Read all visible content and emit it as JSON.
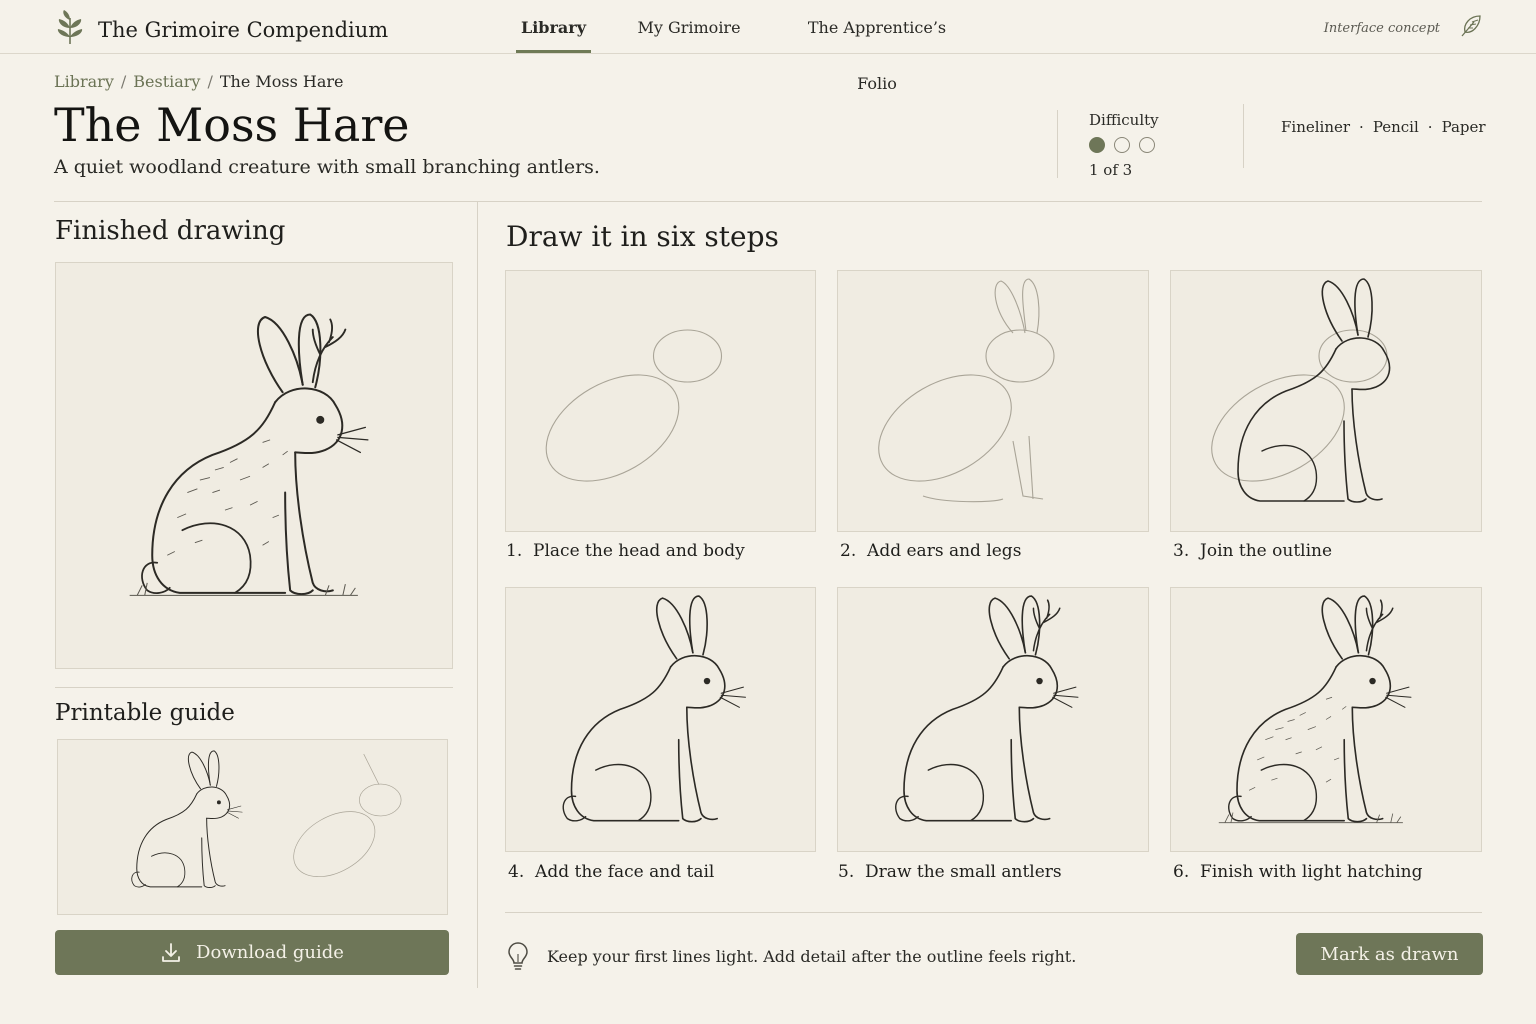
{
  "app": {
    "title": "The Grimoire Compendium",
    "concept_label": "Interface concept"
  },
  "nav": {
    "items": [
      {
        "label": "Library",
        "active": true
      },
      {
        "label": "My Grimoire",
        "active": false
      },
      {
        "label": "The Apprentice’s Folio",
        "active": false
      }
    ]
  },
  "breadcrumb": [
    "Library",
    "Bestiary",
    "The Moss Hare"
  ],
  "page": {
    "title": "The Moss Hare",
    "subtitle": "A quiet woodland creature with small branching antlers."
  },
  "difficulty": {
    "label": "Difficulty",
    "level": 1,
    "max": 3,
    "count_text": "1 of 3"
  },
  "tools": [
    "Fineliner",
    "Pencil",
    "Paper"
  ],
  "finished": {
    "title": "Finished drawing"
  },
  "printable": {
    "title": "Printable guide",
    "download_label": "Download guide"
  },
  "steps": {
    "title": "Draw it in six steps",
    "items": [
      {
        "number": "1.",
        "label": "Place the head and body"
      },
      {
        "number": "2.",
        "label": "Add ears and legs"
      },
      {
        "number": "3.",
        "label": "Join the outline"
      },
      {
        "number": "4.",
        "label": "Add the face and tail"
      },
      {
        "number": "5.",
        "label": "Draw the small antlers"
      },
      {
        "number": "6.",
        "label": "Finish with light hatching"
      }
    ]
  },
  "tip": {
    "text": "Keep your first lines light. Add detail after the outline feels right."
  },
  "mark_button": {
    "label": "Mark as drawn"
  },
  "colors": {
    "accent": "#6e7658",
    "background": "#f5f2ea",
    "panel": "#f0ece2",
    "ink": "#2c2a25"
  }
}
